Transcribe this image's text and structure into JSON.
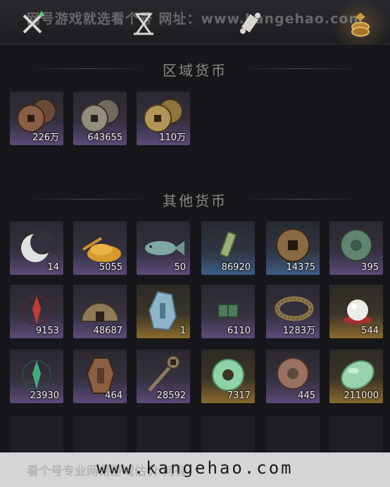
{
  "watermark_top": "网号游戏就选看个号  网址：www.kangehao.com",
  "tabs": [
    {
      "icon": "crossed-swords-icon",
      "active": false
    },
    {
      "icon": "hourglass-icon",
      "active": false
    },
    {
      "icon": "scroll-icon",
      "active": false
    },
    {
      "icon": "coins-icon",
      "active": true
    }
  ],
  "regional": {
    "title": "区域货币",
    "items": [
      {
        "icon": "copper-coins-icon",
        "amount": "226万"
      },
      {
        "icon": "silver-coins-icon",
        "amount": "643655"
      },
      {
        "icon": "gold-coins-icon",
        "amount": "110万"
      }
    ]
  },
  "other": {
    "title": "其他货币",
    "items": [
      {
        "icon": "crescent-moon-jade-icon",
        "amount": "14"
      },
      {
        "icon": "grain-pile-icon",
        "amount": "5055"
      },
      {
        "icon": "jade-fish-icon",
        "amount": "50"
      },
      {
        "icon": "bamboo-token-icon",
        "amount": "86920"
      },
      {
        "icon": "bronze-coin-icon",
        "amount": "14375"
      },
      {
        "icon": "jade-disc-icon",
        "amount": "395"
      },
      {
        "icon": "red-sigil-icon",
        "amount": "9153"
      },
      {
        "icon": "bronze-half-coin-icon",
        "amount": "48687"
      },
      {
        "icon": "jade-stone-icon",
        "amount": "1"
      },
      {
        "icon": "green-map-icon",
        "amount": "6110"
      },
      {
        "icon": "coin-string-icon",
        "amount": "1283万"
      },
      {
        "icon": "pearl-icon",
        "amount": "544"
      },
      {
        "icon": "green-sigil-icon",
        "amount": "23930"
      },
      {
        "icon": "bronze-plaque-icon",
        "amount": "464"
      },
      {
        "icon": "bronze-key-icon",
        "amount": "28592"
      },
      {
        "icon": "jade-ring-icon",
        "amount": "7317"
      },
      {
        "icon": "red-jade-disc-icon",
        "amount": "445"
      },
      {
        "icon": "green-jade-pebble-icon",
        "amount": "211000"
      }
    ]
  },
  "bottom_banner": {
    "url": "www.kangehao.com",
    "ghost": "看个号专业网易游戏估价 何有"
  }
}
